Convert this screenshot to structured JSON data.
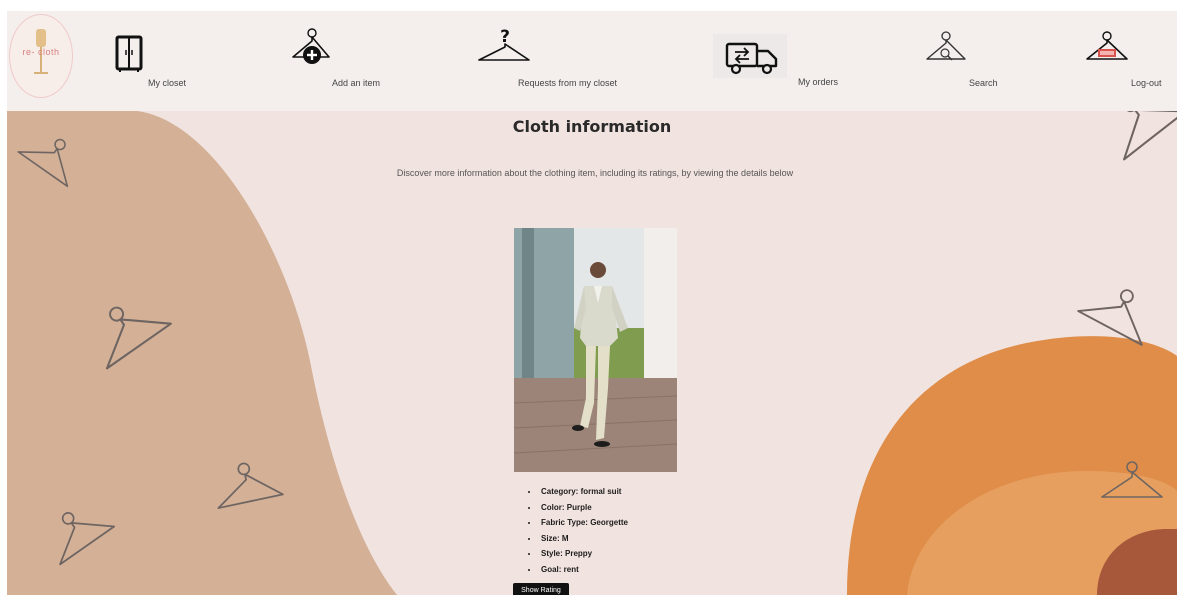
{
  "app": {
    "logo_text": "re- cloth"
  },
  "nav": {
    "items": [
      {
        "id": "my-closet",
        "label": "My closet",
        "icon": "closet-icon"
      },
      {
        "id": "add-item",
        "label": "Add an item",
        "icon": "hanger-plus-icon"
      },
      {
        "id": "requests",
        "label": "Requests from my closet",
        "icon": "hanger-question-icon"
      },
      {
        "id": "my-orders",
        "label": "My orders",
        "icon": "delivery-truck-icon"
      },
      {
        "id": "search",
        "label": "Search",
        "icon": "hanger-search-icon"
      },
      {
        "id": "logout",
        "label": "Log-out",
        "icon": "hanger-exit-icon"
      }
    ]
  },
  "page": {
    "title": "Cloth information",
    "subtitle": "Discover more information about the clothing item, including its ratings, by viewing the details below"
  },
  "item": {
    "details": [
      "Category: formal suit",
      "Color: Purple",
      "Fabric Type: Georgette",
      "Size: M",
      "Style: Preppy",
      "Goal: rent"
    ],
    "show_rating_label": "Show Rating"
  },
  "colors": {
    "page_bg": "#f1e3e0",
    "nav_bg": "#f4efed",
    "left_blob": "#d3b096",
    "orange_blob": "#df8d48",
    "orange_light": "#e79f60",
    "rust": "#a7583b",
    "button_bg": "#111111"
  }
}
